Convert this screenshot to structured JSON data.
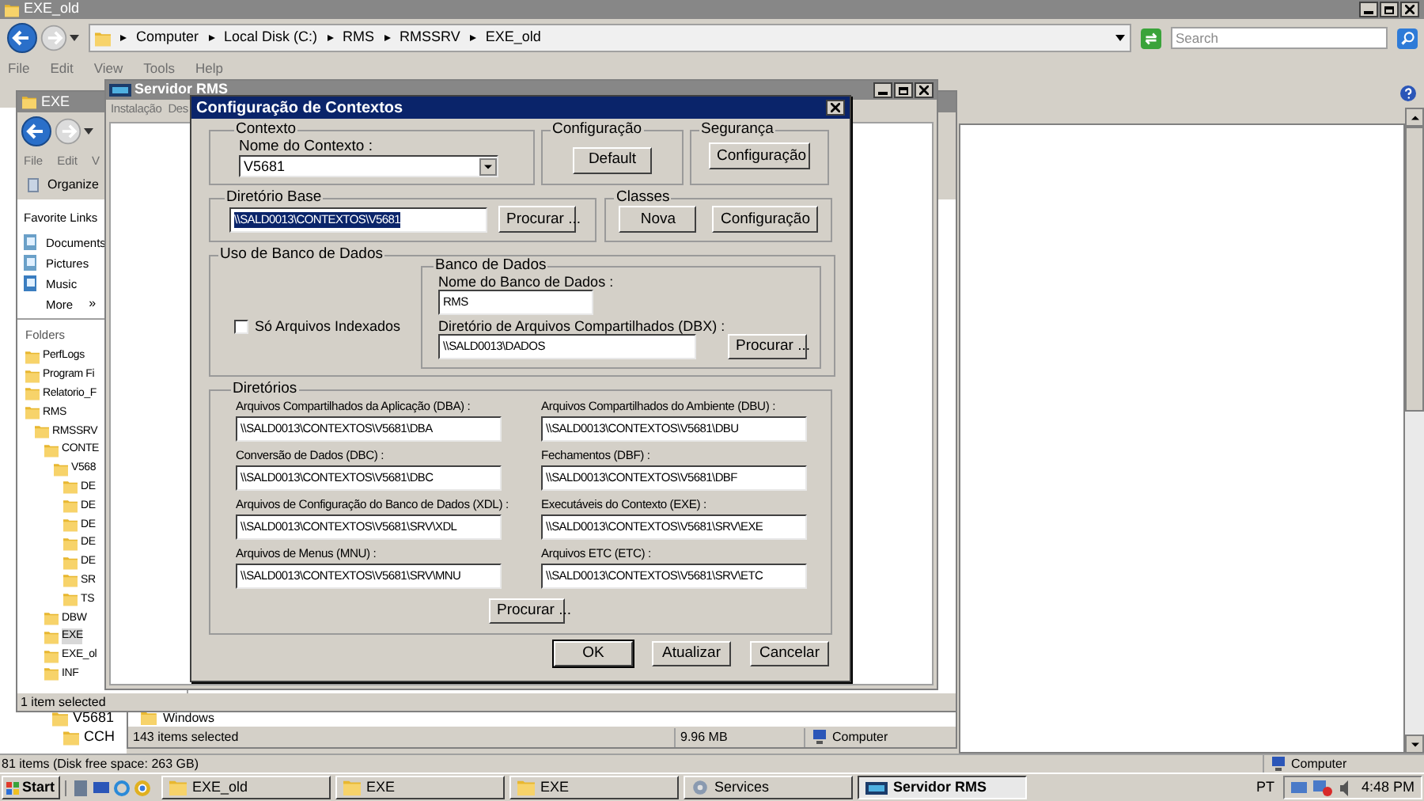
{
  "back_window": {
    "title": "EXE_old",
    "breadcrumb": [
      "Computer",
      "Local Disk (C:)",
      "RMS",
      "RMSSRV",
      "EXE_old"
    ],
    "search": {
      "placeholder": "Search"
    },
    "menu": [
      "File",
      "Edit",
      "View",
      "Tools",
      "Help"
    ],
    "tree": [
      {
        "label": "V5681",
        "children": [
          {
            "label": "CCH"
          }
        ]
      }
    ],
    "status": "81 items (Disk free space: 263 GB)",
    "status_location": "Computer"
  },
  "list_window": {
    "row": "Windows",
    "status": "143 items selected",
    "size": "9.96 MB",
    "location": "Computer"
  },
  "explorer_window": {
    "title": "EXE",
    "menu": [
      "File",
      "Edit",
      "V"
    ],
    "organize": "Organize",
    "favorites_title": "Favorite Links",
    "favorites": [
      {
        "label": "Documents",
        "kind": "documents"
      },
      {
        "label": "Pictures",
        "kind": "pictures"
      },
      {
        "label": "Music",
        "kind": "music"
      },
      {
        "label": "More",
        "kind": "more"
      }
    ],
    "more_glyph": "»",
    "folders_title": "Folders",
    "folders": [
      {
        "label": "PerfLogs",
        "selected": false
      },
      {
        "label": "Program Fi",
        "selected": false
      },
      {
        "label": "Relatorio_F",
        "selected": false
      },
      {
        "label": "RMS",
        "selected": false,
        "children": [
          {
            "label": "RMSSRV",
            "selected": false,
            "children": [
              {
                "label": "CONTE",
                "selected": false,
                "children": [
                  {
                    "label": "V568",
                    "selected": false,
                    "children": [
                      {
                        "label": "DE",
                        "selected": false
                      },
                      {
                        "label": "DE",
                        "selected": false
                      },
                      {
                        "label": "DE",
                        "selected": false
                      },
                      {
                        "label": "DE",
                        "selected": false
                      },
                      {
                        "label": "DE",
                        "selected": false
                      },
                      {
                        "label": "SR",
                        "selected": false
                      },
                      {
                        "label": "TS",
                        "selected": false
                      }
                    ]
                  }
                ]
              },
              {
                "label": "DBW",
                "selected": false
              },
              {
                "label": "EXE",
                "selected": true
              },
              {
                "label": "EXE_ol",
                "selected": false
              },
              {
                "label": "INF",
                "selected": false
              }
            ]
          }
        ]
      }
    ],
    "status": "1 item selected"
  },
  "server_window": {
    "title": "Servidor RMS",
    "menu": [
      "Instalação",
      "Des"
    ]
  },
  "dialog": {
    "title": "Configuração de Contextos",
    "context": {
      "legend": "Contexto",
      "label": "Nome do Contexto :",
      "value": "V5681"
    },
    "configuration": {
      "legend": "Configuração",
      "button": "Default"
    },
    "security": {
      "legend": "Segurança",
      "button": "Configuração"
    },
    "base_dir": {
      "legend": "Diretório Base",
      "value": "\\\\SALD0013\\CONTEXTOS\\V5681",
      "selected": true,
      "button": "Procurar ..."
    },
    "classes": {
      "legend": "Classes",
      "buttons": [
        "Nova",
        "Configuração"
      ]
    },
    "db_usage": {
      "legend": "Uso de Banco de Dados",
      "checkbox": {
        "label": "Só Arquivos Indexados",
        "checked": false
      },
      "database": {
        "legend": "Banco de Dados",
        "name_label": "Nome do Banco de Dados :",
        "name_value": "RMS",
        "dbx_label": "Diretório de Arquivos Compartilhados (DBX) :",
        "dbx_value": "\\\\SALD0013\\DADOS",
        "button": "Procurar ..."
      }
    },
    "directories": {
      "legend": "Diretórios",
      "fields": [
        {
          "label": "Arquivos Compartilhados da Aplicação (DBA) :",
          "value": "\\\\SALD0013\\CONTEXTOS\\V5681\\DBA"
        },
        {
          "label": "Arquivos Compartilhados do Ambiente (DBU) :",
          "value": "\\\\SALD0013\\CONTEXTOS\\V5681\\DBU"
        },
        {
          "label": "Conversão de Dados (DBC) :",
          "value": "\\\\SALD0013\\CONTEXTOS\\V5681\\DBC"
        },
        {
          "label": "Fechamentos (DBF) :",
          "value": "\\\\SALD0013\\CONTEXTOS\\V5681\\DBF"
        },
        {
          "label": "Arquivos de Configuração do Banco de Dados (XDL) :",
          "value": "\\\\SALD0013\\CONTEXTOS\\V5681\\SRV\\XDL"
        },
        {
          "label": "Executáveis do Contexto (EXE) :",
          "value": "\\\\SALD0013\\CONTEXTOS\\V5681\\SRV\\EXE"
        },
        {
          "label": "Arquivos de Menus (MNU) :",
          "value": "\\\\SALD0013\\CONTEXTOS\\V5681\\SRV\\MNU"
        },
        {
          "label": "Arquivos ETC (ETC) :",
          "value": "\\\\SALD0013\\CONTEXTOS\\V5681\\SRV\\ETC"
        }
      ],
      "button": "Procurar ..."
    },
    "buttons": [
      {
        "label": "OK",
        "default": true
      },
      {
        "label": "Atualizar",
        "default": false
      },
      {
        "label": "Cancelar",
        "default": false
      }
    ]
  },
  "taskbar": {
    "start": "Start",
    "tasks": [
      {
        "label": "EXE_old",
        "kind": "folder",
        "selected": false
      },
      {
        "label": "EXE",
        "kind": "folder",
        "selected": false
      },
      {
        "label": "EXE",
        "kind": "folder",
        "selected": false
      },
      {
        "label": "Services",
        "kind": "services",
        "selected": false
      },
      {
        "label": "Servidor RMS",
        "kind": "app",
        "selected": true
      }
    ],
    "language": "PT",
    "clock": "4:48 PM"
  }
}
